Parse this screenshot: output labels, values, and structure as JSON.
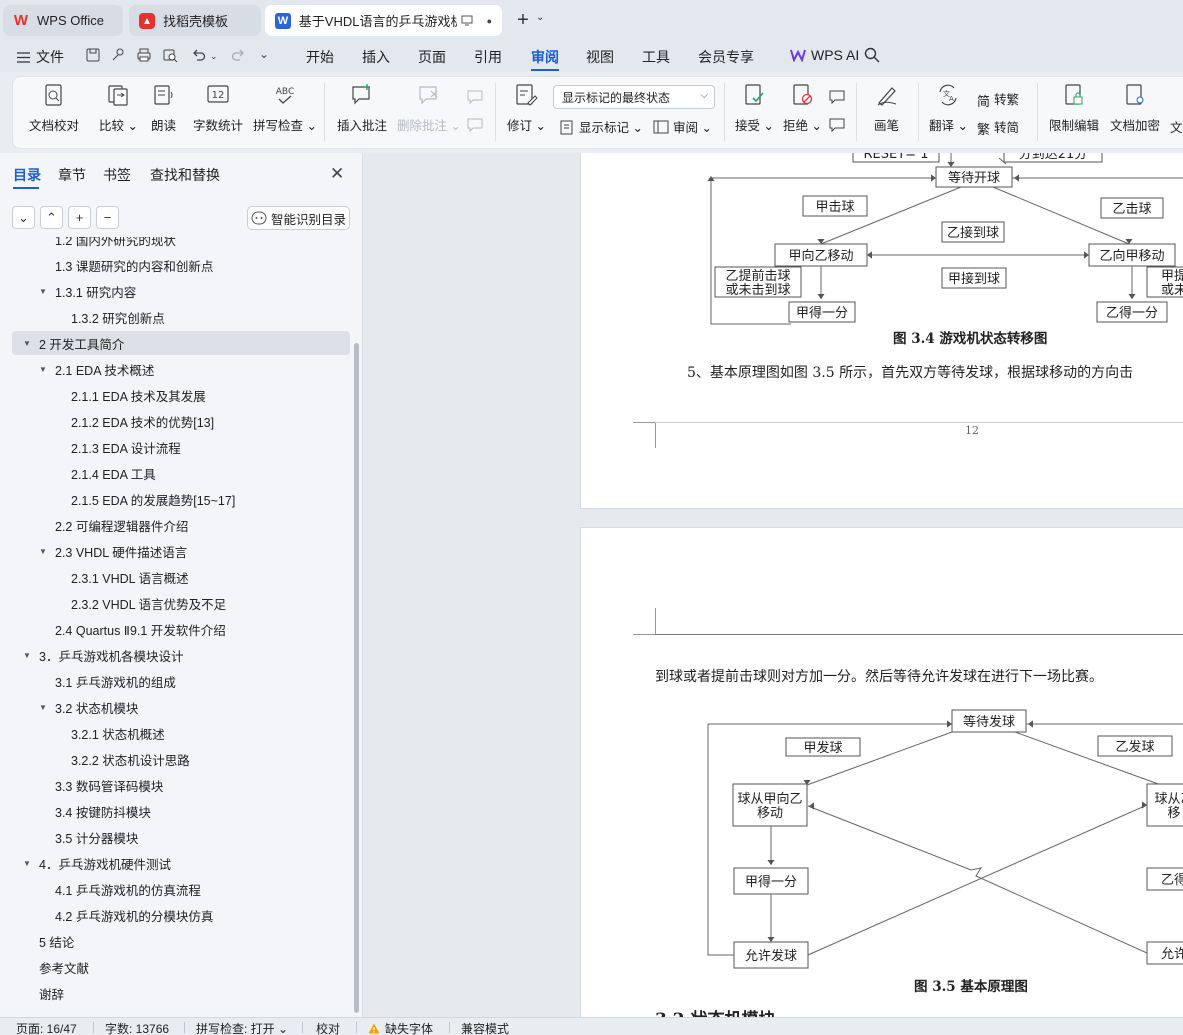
{
  "tabs": {
    "home": "WPS Office",
    "templates": "找稻壳模板",
    "doc": "基于VHDL语言的乒乓游戏机毕",
    "doc_logo": "W",
    "new_tab": "+",
    "new_tab_caret": "⌄",
    "close_dot": "●"
  },
  "menu": {
    "file": "文件",
    "items": [
      "开始",
      "插入",
      "页面",
      "引用",
      "审阅",
      "视图",
      "工具",
      "会员专享"
    ],
    "ai": "WPS AI"
  },
  "ribbon": {
    "proofread": "文档校对",
    "compare": "比较",
    "read_aloud": "朗读",
    "word_count": "字数统计",
    "spell_check": "拼写检查",
    "insert_comment": "插入批注",
    "delete_comment": "删除批注",
    "revise": "修订",
    "markup_state": "显示标记的最终状态",
    "show_markup": "显示标记",
    "review": "审阅",
    "accept": "接受",
    "reject": "拒绝",
    "pen": "画笔",
    "translate": "翻译",
    "to_traditional": "转繁",
    "to_simplified": "转简",
    "restrict_edit": "限制编辑",
    "encrypt": "文档加密",
    "more": "文",
    "icon_word_count": "12",
    "icon_spell": "ABC"
  },
  "panel": {
    "tabs": [
      "目录",
      "章节",
      "书签",
      "查找和替换"
    ],
    "close": "✕",
    "tool_buttons": [
      "⌄",
      "⌃",
      "+",
      "−"
    ],
    "smart_toc": "智能识别目录",
    "toc": [
      {
        "text": "1.2 国内外研究的现状",
        "level": 2
      },
      {
        "text": "1.3 课题研究的内容和创新点",
        "level": 2
      },
      {
        "text": "1.3.1  研究内容",
        "level": 2,
        "arrow": true
      },
      {
        "text": "1.3.2  研究创新点",
        "level": 3
      },
      {
        "text": "2  开发工具简介",
        "level": 1,
        "arrow": true,
        "selected": true
      },
      {
        "text": "2.1 EDA 技术概述",
        "level": 2,
        "arrow": true
      },
      {
        "text": "2.1.1 EDA 技术及其发展",
        "level": 3
      },
      {
        "text": "2.1.2 EDA 技术的优势[13]",
        "level": 3
      },
      {
        "text": "2.1.3 EDA 设计流程",
        "level": 3
      },
      {
        "text": "2.1.4 EDA 工具",
        "level": 3
      },
      {
        "text": "2.1.5 EDA 的发展趋势[15~17]",
        "level": 3
      },
      {
        "text": "2.2 可编程逻辑器件介绍",
        "level": 2
      },
      {
        "text": "2.3 VHDL 硬件描述语言",
        "level": 2,
        "arrow": true
      },
      {
        "text": "2.3.1 VHDL 语言概述",
        "level": 3
      },
      {
        "text": "2.3.2 VHDL 语言优势及不足",
        "level": 3
      },
      {
        "text": "2.4 Quartus Ⅱ9.1 开发软件介绍",
        "level": 2
      },
      {
        "text": "3．乒乓游戏机各模块设计",
        "level": 1,
        "arrow": true
      },
      {
        "text": "3.1 乒乓游戏机的组成",
        "level": 2
      },
      {
        "text": "3.2 状态机模块",
        "level": 2,
        "arrow": true
      },
      {
        "text": "3.2.1  状态机概述",
        "level": 3
      },
      {
        "text": "3.2.2  状态机设计思路",
        "level": 3
      },
      {
        "text": "3.3 数码管译码模块",
        "level": 2
      },
      {
        "text": "3.4 按键防抖模块",
        "level": 2
      },
      {
        "text": "3.5 计分器模块",
        "level": 2
      },
      {
        "text": "4．乒乓游戏机硬件测试",
        "level": 1,
        "arrow": true
      },
      {
        "text": "4.1 乒乓游戏机的仿真流程",
        "level": 2
      },
      {
        "text": "4.2 乒乓游戏机的分模块仿真",
        "level": 2
      },
      {
        "text": "5  结论",
        "level": 1
      },
      {
        "text": "参考文献",
        "level": 1
      },
      {
        "text": "谢辞",
        "level": 1
      }
    ]
  },
  "doc": {
    "fig34": {
      "top_left_box": "RESET= 1",
      "top_right_box": "分到达21分",
      "wait_serve": "等待开球",
      "a_hit": "甲击球",
      "b_catch": "乙接到球",
      "b_hit": "乙击球",
      "a_to_b": "甲向乙移动",
      "b_to_a": "乙向甲移动",
      "a_catch": "甲接到球",
      "b_early_l1": "乙提前击球",
      "b_early_l2": "或未击到球",
      "a_early_l1": "甲提",
      "a_early_l2": "或未",
      "a_score": "甲得一分",
      "b_score": "乙得一分",
      "caption": "图 3.4  游戏机状态转移图"
    },
    "para1": "5、基本原理图如图 3.5 所示，首先双方等待发球，根据球移动的方向击",
    "page_number": "12",
    "para2": "到球或者提前击球则对方加一分。然后等待允许发球在进行下一场比赛。",
    "fig35": {
      "wait_serve": "等待发球",
      "a_serve": "甲发球",
      "b_serve": "乙发球",
      "ball_a_to_b_l1": "球从甲向乙",
      "ball_a_to_b_l2": "移动",
      "ball_b_to_a_l1": "球从乙",
      "ball_b_to_a_l2": "移",
      "a_score": "甲得一分",
      "b_score": "乙得",
      "allow_serve": "允许发球",
      "allow_serve_r": "允许",
      "caption": "图 3.5  基本原理图"
    },
    "next_heading": "3.2 状态机模块"
  },
  "status": {
    "page": "页面: 16/47",
    "words": "字数: 13766",
    "spell": "拼写检查: 打开",
    "proof": "校对",
    "missing_font": "缺失字体",
    "compat": "兼容模式"
  },
  "colors": {
    "accent": "#1a5fd3",
    "wps_red": "#e5322d",
    "doc_blue": "#2b63d9"
  }
}
